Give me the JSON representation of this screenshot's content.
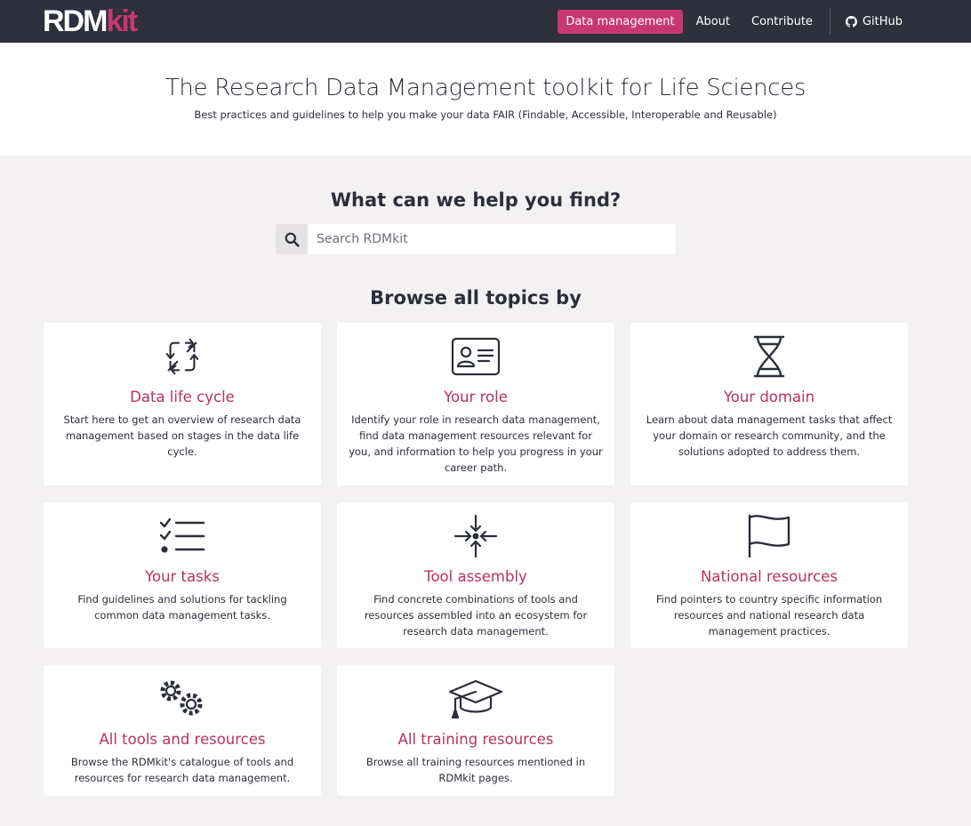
{
  "logo": {
    "part1": "RDM",
    "part2": "kit"
  },
  "nav": {
    "items": [
      {
        "label": "Data management",
        "active": true
      },
      {
        "label": "About",
        "active": false
      },
      {
        "label": "Contribute",
        "active": false
      }
    ],
    "github_label": "GitHub"
  },
  "hero": {
    "title": "The Research Data Management toolkit for Life Sciences",
    "subtitle": "Best practices and guidelines to help you make your data FAIR (Findable, Accessible, Interoperable and Reusable)"
  },
  "search": {
    "heading": "What can we help you find?",
    "placeholder": "Search RDMkit"
  },
  "browse": {
    "heading": "Browse all topics by",
    "cards": [
      {
        "icon": "refresh-icon",
        "title": "Data life cycle",
        "description": "Start here to get an overview of research data management based on stages in the data life cycle."
      },
      {
        "icon": "id-card-icon",
        "title": "Your role",
        "description": "Identify your role in research data management, find data management resources relevant for you, and information to help you progress in your career path."
      },
      {
        "icon": "dna-icon",
        "title": "Your domain",
        "description": "Learn about data management tasks that affect your domain or research community, and the solutions adopted to address them."
      },
      {
        "icon": "checklist-icon",
        "title": "Your tasks",
        "description": "Find guidelines and solutions for tackling common data management tasks."
      },
      {
        "icon": "converge-arrows-icon",
        "title": "Tool assembly",
        "description": "Find concrete combinations of tools and resources assembled into an ecosystem for research data management."
      },
      {
        "icon": "flag-icon",
        "title": "National resources",
        "description": "Find pointers to country specific information resources and national research data management practices."
      },
      {
        "icon": "gears-icon",
        "title": "All tools and resources",
        "description": "Browse the RDMkit's catalogue of tools and resources for research data management."
      },
      {
        "icon": "graduation-cap-icon",
        "title": "All training resources",
        "description": "Browse all training resources mentioned in RDMkit pages."
      }
    ]
  },
  "colors": {
    "navbar": "#2e303e",
    "accent": "#c83771",
    "card_title": "#b9325f",
    "background": "#f3f1f1"
  }
}
